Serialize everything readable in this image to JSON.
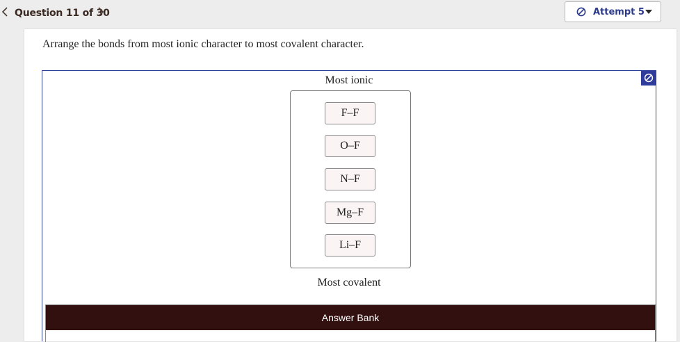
{
  "header": {
    "question_label": "Question 11 of 30",
    "attempt_label": "Attempt 5"
  },
  "question": {
    "prompt": "Arrange the bonds from most ionic character to most covalent character."
  },
  "ranking": {
    "top_label": "Most ionic",
    "bottom_label": "Most covalent",
    "items": [
      "F–F",
      "O–F",
      "N–F",
      "Mg–F",
      "Li–F"
    ]
  },
  "answer_bank": {
    "title": "Answer Bank"
  },
  "colors": {
    "accent": "#2f3c9a",
    "answer_bank_header": "#331010",
    "tile_background": "#faf4f4"
  },
  "icons": {
    "prev": "chevron-left-icon",
    "next": "chevron-right-icon",
    "attempt": "no-entry-icon",
    "reset": "no-entry-icon",
    "dropdown": "caret-down-icon"
  }
}
